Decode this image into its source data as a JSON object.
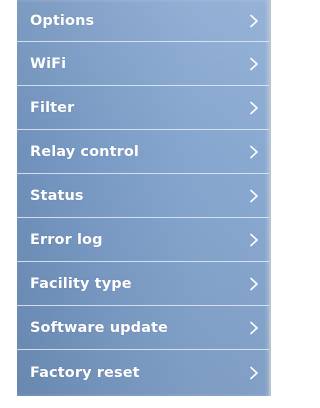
{
  "menu": {
    "items": [
      {
        "label": "Options",
        "icon": "chevron-right-icon"
      },
      {
        "label": "WiFi",
        "icon": "chevron-right-icon"
      },
      {
        "label": "Filter",
        "icon": "chevron-right-icon"
      },
      {
        "label": "Relay control",
        "icon": "chevron-right-icon"
      },
      {
        "label": "Status",
        "icon": "chevron-right-icon"
      },
      {
        "label": "Error log",
        "icon": "chevron-right-icon"
      },
      {
        "label": "Facility type",
        "icon": "chevron-right-icon"
      },
      {
        "label": "Software update",
        "icon": "chevron-right-icon"
      },
      {
        "label": "Factory reset",
        "icon": "chevron-right-icon"
      }
    ]
  },
  "colors": {
    "screen_background": "#7b9cc6",
    "text": "#ffffff",
    "divider": "#e1ebf8"
  }
}
